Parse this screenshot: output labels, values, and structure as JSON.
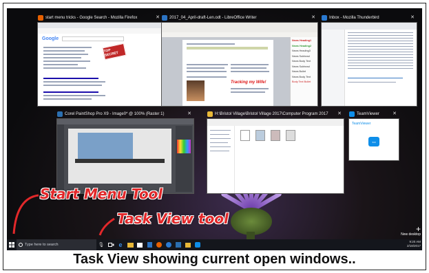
{
  "windows": [
    {
      "title": "start menu tricks - Google Search - Mozilla Firefox",
      "icon": "firefox-icon",
      "icon_color": "#e66000"
    },
    {
      "title": "2017_04_April-draft-Len.odt - LibreOffice Writer",
      "icon": "writer-icon",
      "icon_color": "#2b73c2"
    },
    {
      "title": "Inbox - Mozilla Thunderbird",
      "icon": "thunderbird-icon",
      "icon_color": "#2a7ad1"
    },
    {
      "title": "Corel PaintShop Pro X9 - Image0* @ 100% (Raster 1)",
      "icon": "paintshop-icon",
      "icon_color": "#2b6fb0"
    },
    {
      "title": "H:\\Bristol Village\\Bristol Village 2017\\Computer Program 2017",
      "icon": "folder-icon",
      "icon_color": "#e8b838"
    },
    {
      "title": "TeamViewer",
      "icon": "teamviewer-icon",
      "icon_color": "#0e8ee9"
    }
  ],
  "firefox_content": {
    "badge": "TOP SECRET"
  },
  "writer_content": {
    "sidebar_items": [
      "News Heading1",
      "News Heading2",
      "News Heading3",
      "News Subhead",
      "News Body Text",
      "News Subhead",
      "News Bullet",
      "News Body Text",
      "Body Text Bullet"
    ],
    "highlight_text": "Tracking my Wife!"
  },
  "teamviewer_content": {
    "label": "TeamViewer"
  },
  "taskbar": {
    "search_placeholder": "Type here to search",
    "clock_time": "9:20 AM",
    "clock_date": "2/18/2017"
  },
  "new_desktop_label": "New desktop",
  "annotations": {
    "start_menu": "Start Menu Tool",
    "task_view": "Task View tool"
  },
  "caption": "Task View showing current open windows.."
}
